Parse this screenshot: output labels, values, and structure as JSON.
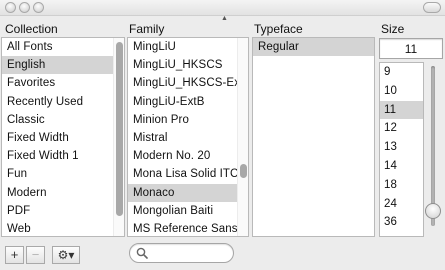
{
  "headers": {
    "collection": "Collection",
    "family": "Family",
    "typeface": "Typeface",
    "size": "Size"
  },
  "collections": [
    {
      "label": "All Fonts",
      "selected": false
    },
    {
      "label": "English",
      "selected": true
    },
    {
      "label": "Favorites",
      "selected": false
    },
    {
      "label": "Recently Used",
      "selected": false
    },
    {
      "label": "Classic",
      "selected": false
    },
    {
      "label": "Fixed Width",
      "selected": false
    },
    {
      "label": "Fixed Width 1",
      "selected": false
    },
    {
      "label": "Fun",
      "selected": false
    },
    {
      "label": "Modern",
      "selected": false
    },
    {
      "label": "PDF",
      "selected": false
    },
    {
      "label": "Web",
      "selected": false
    }
  ],
  "families": [
    {
      "label": "MingLiU",
      "selected": false
    },
    {
      "label": "MingLiU_HKSCS",
      "selected": false
    },
    {
      "label": "MingLiU_HKSCS-ExtB",
      "selected": false
    },
    {
      "label": "MingLiU-ExtB",
      "selected": false
    },
    {
      "label": "Minion Pro",
      "selected": false
    },
    {
      "label": "Mistral",
      "selected": false
    },
    {
      "label": "Modern No. 20",
      "selected": false
    },
    {
      "label": "Mona Lisa Solid ITC TT",
      "selected": false
    },
    {
      "label": "Monaco",
      "selected": true
    },
    {
      "label": "Mongolian Baiti",
      "selected": false
    },
    {
      "label": "MS Reference Sans Serif",
      "selected": false
    }
  ],
  "typefaces": [
    {
      "label": "Regular",
      "selected": true
    }
  ],
  "size": {
    "value": "11",
    "options": [
      {
        "label": "9",
        "selected": false
      },
      {
        "label": "10",
        "selected": false
      },
      {
        "label": "11",
        "selected": true
      },
      {
        "label": "12",
        "selected": false
      },
      {
        "label": "13",
        "selected": false
      },
      {
        "label": "14",
        "selected": false
      },
      {
        "label": "18",
        "selected": false
      },
      {
        "label": "24",
        "selected": false
      },
      {
        "label": "36",
        "selected": false
      }
    ],
    "slider_level": 0.92
  },
  "toolbar": {
    "add_label": "+",
    "remove_label": "−",
    "action_label": "⚙▾"
  },
  "search": {
    "value": "",
    "placeholder": ""
  }
}
